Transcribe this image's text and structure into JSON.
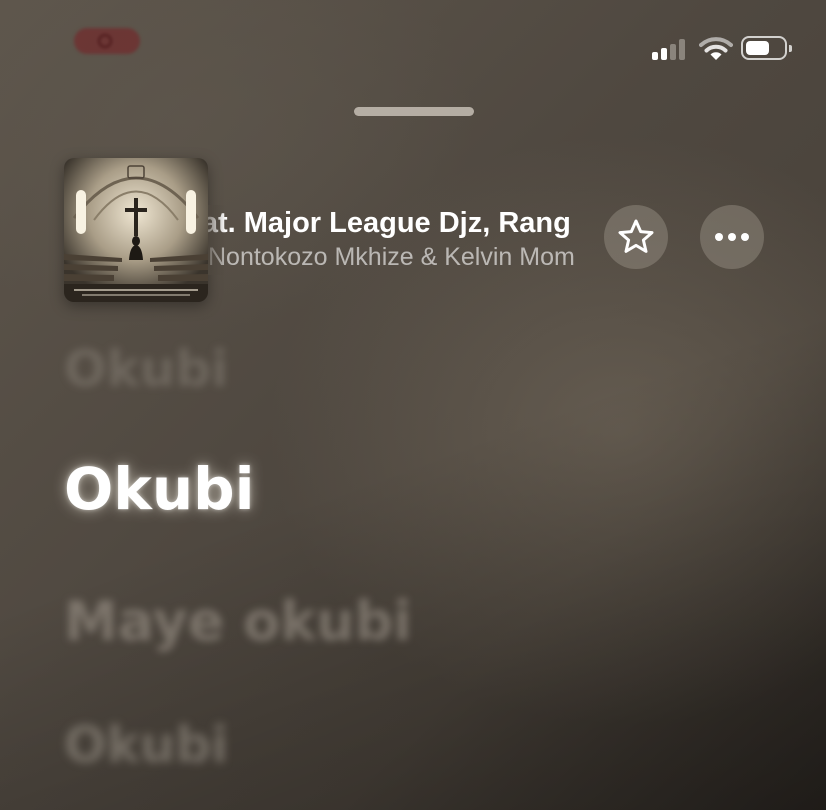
{
  "status_bar": {
    "colors": {
      "indicator": "#7a1e23",
      "signal_active": "#ffffff",
      "signal_dim": "#8a847c"
    },
    "icons": [
      "recording-indicator-icon",
      "cellular-signal-icon",
      "wifi-icon",
      "battery-icon"
    ],
    "battery_level": 0.54,
    "signal_bars_active": 2,
    "signal_bars_total": 4
  },
  "now_playing": {
    "title": "Feat. Major League Djz, Rang",
    "artist": "Nontokozo Mkhize & Kelvin Mom",
    "artwork_icon": "church-album-artwork",
    "favorite_icon": "star-icon",
    "more_icon": "ellipsis-icon"
  },
  "lyrics": {
    "previous": "Okubi",
    "current": "Okubi",
    "next": [
      "Maye okubi",
      "Okubi"
    ]
  }
}
